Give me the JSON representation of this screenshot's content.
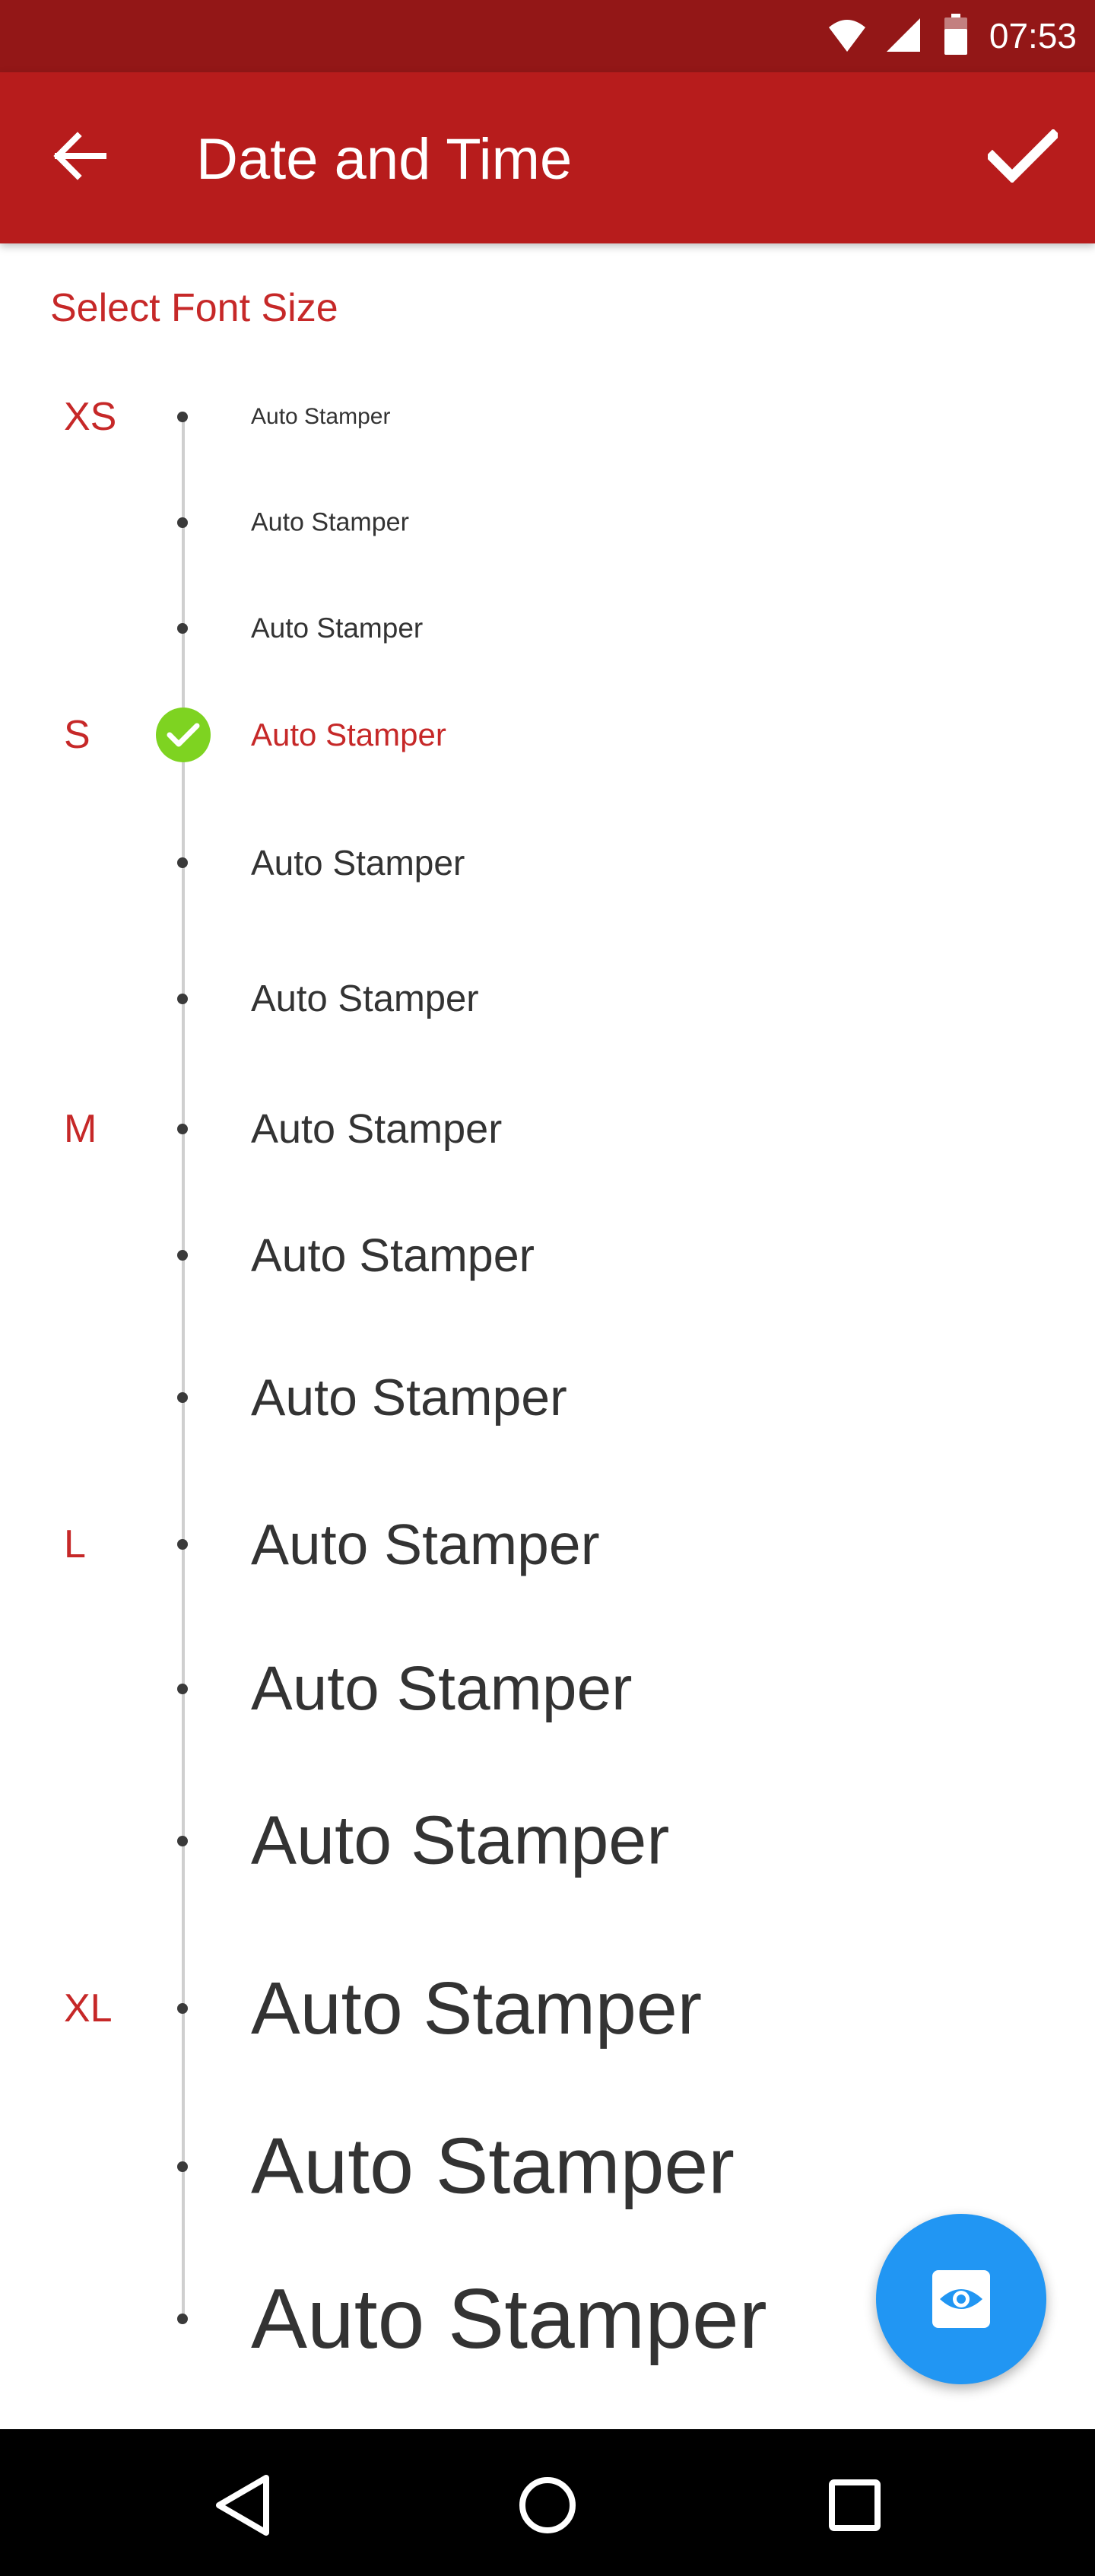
{
  "status_bar": {
    "time": "07:53",
    "icons": [
      "wifi-icon",
      "signal-icon",
      "battery-icon"
    ]
  },
  "app_bar": {
    "title": "Date and Time",
    "back_icon": "arrow-left-icon",
    "confirm_icon": "check-icon"
  },
  "section_label": "Select Font Size",
  "categories": [
    "XS",
    "S",
    "M",
    "L",
    "XL"
  ],
  "sizes": [
    {
      "text": "Auto Stamper",
      "category": "XS",
      "selected": false
    },
    {
      "text": "Auto Stamper",
      "category": "",
      "selected": false
    },
    {
      "text": "Auto Stamper",
      "category": "",
      "selected": false
    },
    {
      "text": "Auto Stamper",
      "category": "S",
      "selected": true
    },
    {
      "text": "Auto Stamper",
      "category": "",
      "selected": false
    },
    {
      "text": "Auto Stamper",
      "category": "",
      "selected": false
    },
    {
      "text": "Auto Stamper",
      "category": "M",
      "selected": false
    },
    {
      "text": "Auto Stamper",
      "category": "",
      "selected": false
    },
    {
      "text": "Auto Stamper",
      "category": "",
      "selected": false
    },
    {
      "text": "Auto Stamper",
      "category": "L",
      "selected": false
    },
    {
      "text": "Auto Stamper",
      "category": "",
      "selected": false
    },
    {
      "text": "Auto Stamper",
      "category": "",
      "selected": false
    },
    {
      "text": "Auto Stamper",
      "category": "XL",
      "selected": false
    },
    {
      "text": "Auto Stamper",
      "category": "",
      "selected": false
    },
    {
      "text": "Auto Stamper",
      "category": "",
      "selected": false
    }
  ],
  "fab": {
    "icon": "eye-icon"
  },
  "nav_bar": {
    "icons": [
      "back-triangle-icon",
      "home-circle-icon",
      "recents-square-icon"
    ]
  },
  "colors": {
    "status_bar": "#931717",
    "app_bar": "#b71c1c",
    "accent": "#c62828",
    "selected_check": "#7ed321",
    "fab": "#2196f3",
    "text": "#333333"
  }
}
